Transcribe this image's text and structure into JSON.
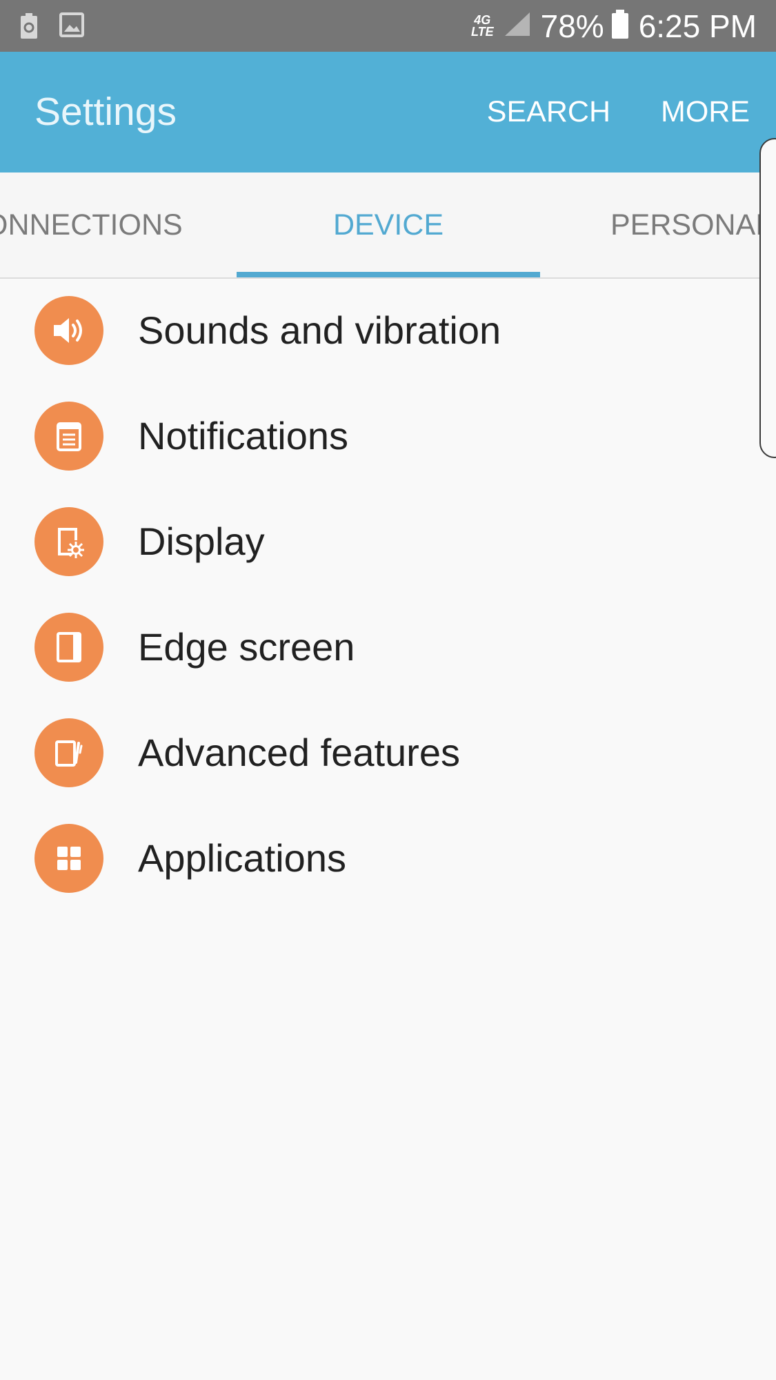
{
  "status_bar": {
    "network_top": "4G",
    "network_bottom": "LTE",
    "battery_percent": "78%",
    "time": "6:25 PM",
    "left_icons": [
      "battery-saver-icon",
      "image-icon"
    ],
    "right_icons": [
      "signal-icon",
      "battery-icon"
    ]
  },
  "app_bar": {
    "title": "Settings",
    "search_label": "SEARCH",
    "more_label": "MORE"
  },
  "tabs": [
    {
      "label": "ONNECTIONS",
      "selected": false
    },
    {
      "label": "DEVICE",
      "selected": true
    },
    {
      "label": "PERSONAL",
      "selected": false
    }
  ],
  "items": [
    {
      "label": "Sounds and vibration",
      "icon": "speaker-icon"
    },
    {
      "label": "Notifications",
      "icon": "notification-icon"
    },
    {
      "label": "Display",
      "icon": "display-brightness-icon"
    },
    {
      "label": "Edge screen",
      "icon": "edge-screen-icon"
    },
    {
      "label": "Advanced features",
      "icon": "advanced-features-icon"
    },
    {
      "label": "Applications",
      "icon": "applications-icon"
    }
  ],
  "colors": {
    "status_bar": "#767676",
    "app_bar": "#52b0d6",
    "accent": "#52a9d1",
    "icon_background": "#f08d4f",
    "background": "#f9f9f9"
  }
}
